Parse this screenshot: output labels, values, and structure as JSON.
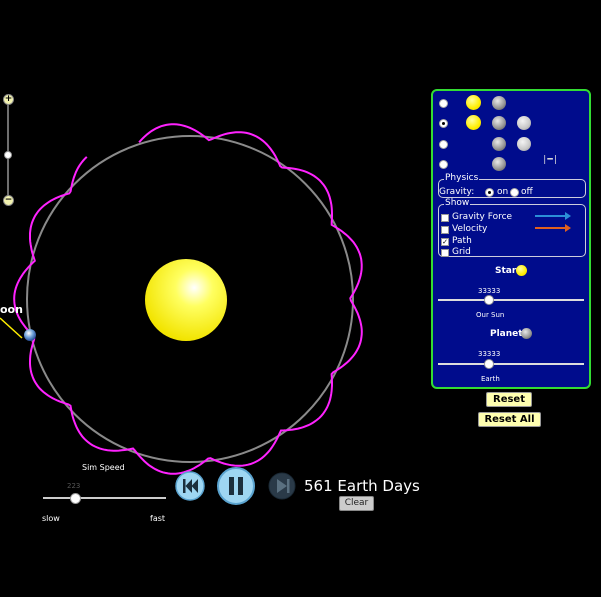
{
  "zoom": {
    "in": "+",
    "out": "−"
  },
  "sim_label": "oon",
  "panel": {
    "physics": {
      "title": "Physics",
      "gravity_label": "Gravity:",
      "on": "on",
      "off": "off"
    },
    "show": {
      "title": "Show",
      "items": [
        {
          "label": "Gravity Force",
          "checked": false
        },
        {
          "label": "Velocity",
          "checked": false
        },
        {
          "label": "Path",
          "checked": true
        },
        {
          "label": "Grid",
          "checked": false
        }
      ]
    },
    "star": {
      "label": "Star",
      "value": "33333",
      "name": "Our Sun"
    },
    "planet": {
      "label": "Planet",
      "value": "33333",
      "name": "Earth"
    },
    "station_icon": "space-station-icon"
  },
  "buttons": {
    "reset": "Reset",
    "reset_all": "Reset All"
  },
  "sim_speed": {
    "label": "Sim Speed",
    "value": "223",
    "slow": "slow",
    "fast": "fast"
  },
  "days": "561 Earth Days",
  "clear": "Clear",
  "colors": {
    "panel_bg": "#000c8c",
    "panel_border": "#33dd33",
    "path": "#ff22ff",
    "orbit": "#8a8a8a",
    "sun": "#ffee00"
  }
}
